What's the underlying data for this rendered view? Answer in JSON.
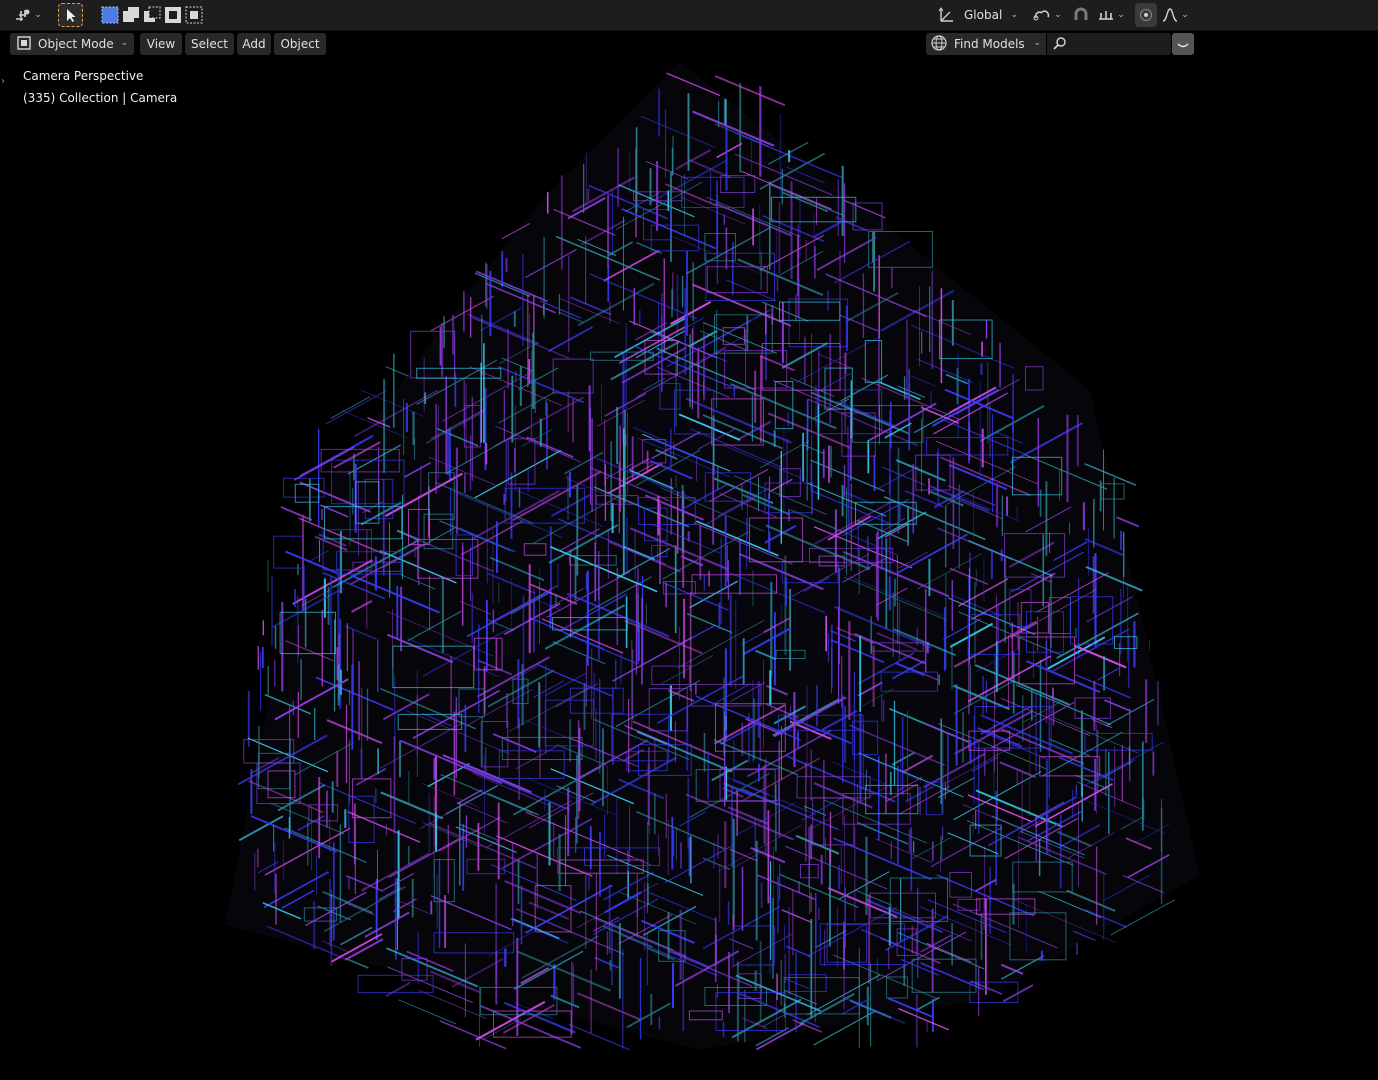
{
  "tool_header": {
    "transform_orientation": "Global",
    "icons": [
      "editor-type-icon",
      "select-tool-icon",
      "select-box-new-icon",
      "select-box-extend-icon",
      "select-box-subtract-icon",
      "select-box-invert-icon",
      "select-box-intersect-icon",
      "orientation-icon",
      "pivot-icon",
      "snap-magnet-icon",
      "snap-increment-icon",
      "proportional-edit-icon",
      "falloff-curve-icon"
    ]
  },
  "viewport_header": {
    "mode_label": "Object Mode",
    "menus": [
      "View",
      "Select",
      "Add",
      "Object"
    ],
    "asset_button_label": "Find Models",
    "search_placeholder": ""
  },
  "viewport_overlay": {
    "line1": "Camera Perspective",
    "line2": "(335) Collection | Camera"
  },
  "scene": {
    "object": "wireframe fractal cube",
    "colors": {
      "cyan": "#37c8e6",
      "blue": "#3a3af5",
      "violet": "#8a3ad8",
      "magenta": "#d44ae8",
      "teal": "#2f8c9a",
      "background": "#000000"
    }
  },
  "colors": {
    "header_bg": "#1d1d1d",
    "button_bg": "#282828",
    "active_tool_outline": "#e8a23b",
    "select_mode_blue": "#4d7be0"
  }
}
